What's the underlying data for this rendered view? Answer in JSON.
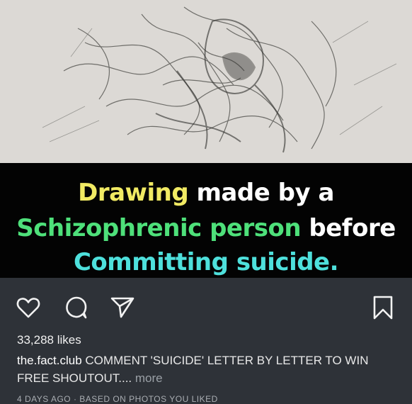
{
  "banner": {
    "line1_word": "Drawing",
    "line1_rest": "made by a",
    "line2_word": "Schizophrenic person",
    "line2_rest": "before",
    "line3": "Committing suicide."
  },
  "actions": {
    "like_icon": "heart-icon",
    "comment_icon": "comment-icon",
    "share_icon": "share-icon",
    "save_icon": "bookmark-icon"
  },
  "post": {
    "likes": "33,288 likes",
    "username": "the.fact.club",
    "caption": "COMMENT 'SUICIDE' LETTER BY LETTER TO WIN FREE SHOUTOUT....",
    "more": "more",
    "meta": "4 DAYS AGO · BASED ON PHOTOS YOU LIKED"
  },
  "colors": {
    "yellow": "#f1ea63",
    "green": "#4ee07a",
    "cyan": "#4ee0dc",
    "background": "#2e3238"
  }
}
